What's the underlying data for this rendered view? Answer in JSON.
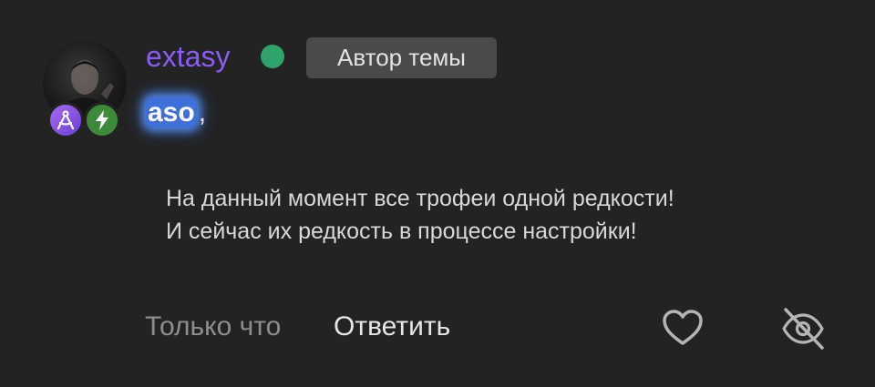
{
  "post": {
    "author": {
      "username": "extasy",
      "username_color": "#8a5cf5",
      "online": true,
      "online_color": "#2fa36b",
      "author_label": "Автор темы",
      "badges": [
        {
          "icon": "compass-icon",
          "color": "#8f55e8"
        },
        {
          "icon": "lightning-icon",
          "color": "#3d8a3a"
        }
      ]
    },
    "mention": {
      "name": "aso",
      "suffix": ","
    },
    "message": {
      "lines": [
        "На данный момент все трофеи одной редкости!",
        "И сейчас их редкость в процессе настройки!"
      ]
    },
    "footer": {
      "timestamp": "Только что",
      "reply_label": "Ответить",
      "like_icon": "heart-icon",
      "hide_icon": "eye-off-icon"
    }
  }
}
